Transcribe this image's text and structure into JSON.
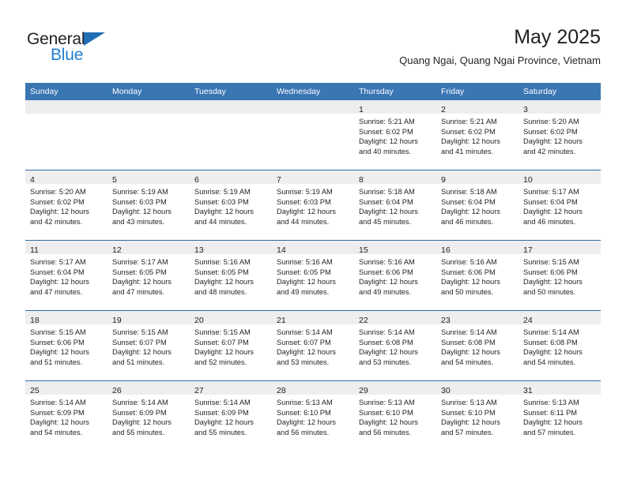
{
  "brand": {
    "name_part1": "General",
    "name_part2": "Blue",
    "triangle_icon": "triangle-icon",
    "colors": {
      "general_text": "#231f20",
      "blue_text": "#1f7fd1",
      "triangle": "#1f6eb4"
    }
  },
  "header": {
    "title": "May 2025",
    "subtitle": "Quang Ngai, Quang Ngai Province, Vietnam"
  },
  "theme": {
    "header_row_bg": "#3a76b4",
    "header_row_text": "#ffffff",
    "week_divider": "#2e6da4",
    "daynum_band_bg": "#eeeeee",
    "body_text": "#231f20"
  },
  "calendar": {
    "weekday_headers": [
      "Sunday",
      "Monday",
      "Tuesday",
      "Wednesday",
      "Thursday",
      "Friday",
      "Saturday"
    ],
    "weeks": [
      [
        {
          "empty": true,
          "day": "",
          "sunrise": "",
          "sunset": "",
          "daylight_line1": "",
          "daylight_line2": ""
        },
        {
          "empty": true,
          "day": "",
          "sunrise": "",
          "sunset": "",
          "daylight_line1": "",
          "daylight_line2": ""
        },
        {
          "empty": true,
          "day": "",
          "sunrise": "",
          "sunset": "",
          "daylight_line1": "",
          "daylight_line2": ""
        },
        {
          "empty": true,
          "day": "",
          "sunrise": "",
          "sunset": "",
          "daylight_line1": "",
          "daylight_line2": ""
        },
        {
          "empty": false,
          "day": "1",
          "sunrise": "Sunrise: 5:21 AM",
          "sunset": "Sunset: 6:02 PM",
          "daylight_line1": "Daylight: 12 hours",
          "daylight_line2": "and 40 minutes."
        },
        {
          "empty": false,
          "day": "2",
          "sunrise": "Sunrise: 5:21 AM",
          "sunset": "Sunset: 6:02 PM",
          "daylight_line1": "Daylight: 12 hours",
          "daylight_line2": "and 41 minutes."
        },
        {
          "empty": false,
          "day": "3",
          "sunrise": "Sunrise: 5:20 AM",
          "sunset": "Sunset: 6:02 PM",
          "daylight_line1": "Daylight: 12 hours",
          "daylight_line2": "and 42 minutes."
        }
      ],
      [
        {
          "empty": false,
          "day": "4",
          "sunrise": "Sunrise: 5:20 AM",
          "sunset": "Sunset: 6:02 PM",
          "daylight_line1": "Daylight: 12 hours",
          "daylight_line2": "and 42 minutes."
        },
        {
          "empty": false,
          "day": "5",
          "sunrise": "Sunrise: 5:19 AM",
          "sunset": "Sunset: 6:03 PM",
          "daylight_line1": "Daylight: 12 hours",
          "daylight_line2": "and 43 minutes."
        },
        {
          "empty": false,
          "day": "6",
          "sunrise": "Sunrise: 5:19 AM",
          "sunset": "Sunset: 6:03 PM",
          "daylight_line1": "Daylight: 12 hours",
          "daylight_line2": "and 44 minutes."
        },
        {
          "empty": false,
          "day": "7",
          "sunrise": "Sunrise: 5:19 AM",
          "sunset": "Sunset: 6:03 PM",
          "daylight_line1": "Daylight: 12 hours",
          "daylight_line2": "and 44 minutes."
        },
        {
          "empty": false,
          "day": "8",
          "sunrise": "Sunrise: 5:18 AM",
          "sunset": "Sunset: 6:04 PM",
          "daylight_line1": "Daylight: 12 hours",
          "daylight_line2": "and 45 minutes."
        },
        {
          "empty": false,
          "day": "9",
          "sunrise": "Sunrise: 5:18 AM",
          "sunset": "Sunset: 6:04 PM",
          "daylight_line1": "Daylight: 12 hours",
          "daylight_line2": "and 46 minutes."
        },
        {
          "empty": false,
          "day": "10",
          "sunrise": "Sunrise: 5:17 AM",
          "sunset": "Sunset: 6:04 PM",
          "daylight_line1": "Daylight: 12 hours",
          "daylight_line2": "and 46 minutes."
        }
      ],
      [
        {
          "empty": false,
          "day": "11",
          "sunrise": "Sunrise: 5:17 AM",
          "sunset": "Sunset: 6:04 PM",
          "daylight_line1": "Daylight: 12 hours",
          "daylight_line2": "and 47 minutes."
        },
        {
          "empty": false,
          "day": "12",
          "sunrise": "Sunrise: 5:17 AM",
          "sunset": "Sunset: 6:05 PM",
          "daylight_line1": "Daylight: 12 hours",
          "daylight_line2": "and 47 minutes."
        },
        {
          "empty": false,
          "day": "13",
          "sunrise": "Sunrise: 5:16 AM",
          "sunset": "Sunset: 6:05 PM",
          "daylight_line1": "Daylight: 12 hours",
          "daylight_line2": "and 48 minutes."
        },
        {
          "empty": false,
          "day": "14",
          "sunrise": "Sunrise: 5:16 AM",
          "sunset": "Sunset: 6:05 PM",
          "daylight_line1": "Daylight: 12 hours",
          "daylight_line2": "and 49 minutes."
        },
        {
          "empty": false,
          "day": "15",
          "sunrise": "Sunrise: 5:16 AM",
          "sunset": "Sunset: 6:06 PM",
          "daylight_line1": "Daylight: 12 hours",
          "daylight_line2": "and 49 minutes."
        },
        {
          "empty": false,
          "day": "16",
          "sunrise": "Sunrise: 5:16 AM",
          "sunset": "Sunset: 6:06 PM",
          "daylight_line1": "Daylight: 12 hours",
          "daylight_line2": "and 50 minutes."
        },
        {
          "empty": false,
          "day": "17",
          "sunrise": "Sunrise: 5:15 AM",
          "sunset": "Sunset: 6:06 PM",
          "daylight_line1": "Daylight: 12 hours",
          "daylight_line2": "and 50 minutes."
        }
      ],
      [
        {
          "empty": false,
          "day": "18",
          "sunrise": "Sunrise: 5:15 AM",
          "sunset": "Sunset: 6:06 PM",
          "daylight_line1": "Daylight: 12 hours",
          "daylight_line2": "and 51 minutes."
        },
        {
          "empty": false,
          "day": "19",
          "sunrise": "Sunrise: 5:15 AM",
          "sunset": "Sunset: 6:07 PM",
          "daylight_line1": "Daylight: 12 hours",
          "daylight_line2": "and 51 minutes."
        },
        {
          "empty": false,
          "day": "20",
          "sunrise": "Sunrise: 5:15 AM",
          "sunset": "Sunset: 6:07 PM",
          "daylight_line1": "Daylight: 12 hours",
          "daylight_line2": "and 52 minutes."
        },
        {
          "empty": false,
          "day": "21",
          "sunrise": "Sunrise: 5:14 AM",
          "sunset": "Sunset: 6:07 PM",
          "daylight_line1": "Daylight: 12 hours",
          "daylight_line2": "and 53 minutes."
        },
        {
          "empty": false,
          "day": "22",
          "sunrise": "Sunrise: 5:14 AM",
          "sunset": "Sunset: 6:08 PM",
          "daylight_line1": "Daylight: 12 hours",
          "daylight_line2": "and 53 minutes."
        },
        {
          "empty": false,
          "day": "23",
          "sunrise": "Sunrise: 5:14 AM",
          "sunset": "Sunset: 6:08 PM",
          "daylight_line1": "Daylight: 12 hours",
          "daylight_line2": "and 54 minutes."
        },
        {
          "empty": false,
          "day": "24",
          "sunrise": "Sunrise: 5:14 AM",
          "sunset": "Sunset: 6:08 PM",
          "daylight_line1": "Daylight: 12 hours",
          "daylight_line2": "and 54 minutes."
        }
      ],
      [
        {
          "empty": false,
          "day": "25",
          "sunrise": "Sunrise: 5:14 AM",
          "sunset": "Sunset: 6:09 PM",
          "daylight_line1": "Daylight: 12 hours",
          "daylight_line2": "and 54 minutes."
        },
        {
          "empty": false,
          "day": "26",
          "sunrise": "Sunrise: 5:14 AM",
          "sunset": "Sunset: 6:09 PM",
          "daylight_line1": "Daylight: 12 hours",
          "daylight_line2": "and 55 minutes."
        },
        {
          "empty": false,
          "day": "27",
          "sunrise": "Sunrise: 5:14 AM",
          "sunset": "Sunset: 6:09 PM",
          "daylight_line1": "Daylight: 12 hours",
          "daylight_line2": "and 55 minutes."
        },
        {
          "empty": false,
          "day": "28",
          "sunrise": "Sunrise: 5:13 AM",
          "sunset": "Sunset: 6:10 PM",
          "daylight_line1": "Daylight: 12 hours",
          "daylight_line2": "and 56 minutes."
        },
        {
          "empty": false,
          "day": "29",
          "sunrise": "Sunrise: 5:13 AM",
          "sunset": "Sunset: 6:10 PM",
          "daylight_line1": "Daylight: 12 hours",
          "daylight_line2": "and 56 minutes."
        },
        {
          "empty": false,
          "day": "30",
          "sunrise": "Sunrise: 5:13 AM",
          "sunset": "Sunset: 6:10 PM",
          "daylight_line1": "Daylight: 12 hours",
          "daylight_line2": "and 57 minutes."
        },
        {
          "empty": false,
          "day": "31",
          "sunrise": "Sunrise: 5:13 AM",
          "sunset": "Sunset: 6:11 PM",
          "daylight_line1": "Daylight: 12 hours",
          "daylight_line2": "and 57 minutes."
        }
      ]
    ]
  }
}
